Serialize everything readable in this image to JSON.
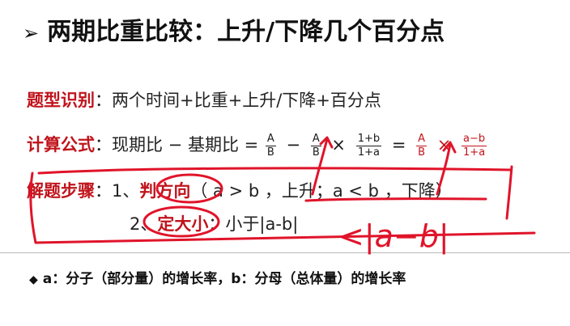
{
  "title": {
    "bullet": "➢",
    "text": "两期比重比较：上升/下降几个百分点"
  },
  "identify": {
    "label": "题型识别",
    "colon": "：",
    "text": "两个时间+比重+上升/下降+百分点"
  },
  "formula": {
    "label": "计算公式",
    "colon": "：",
    "text": "现期比 − 基期比 =",
    "f1": {
      "num": "A",
      "den": "B"
    },
    "minus": "−",
    "f2": {
      "num": "A",
      "den": "B"
    },
    "times1": "×",
    "f3": {
      "num": "1+b",
      "den": "1+a"
    },
    "eq": "=",
    "f4": {
      "num": "A",
      "den": "B"
    },
    "times2": "×",
    "f5": {
      "num": "a−b",
      "den": "1+a"
    }
  },
  "steps": {
    "label": "解题步骤",
    "colon": "：",
    "step1": {
      "num": "1、",
      "key": "判方向",
      "rest": "（ a > b ，上升；a < b ，下降）"
    },
    "step2": {
      "num": "2、",
      "key": "定大小",
      "rest": "：小于|a-b|"
    }
  },
  "handwriting": {
    "text": "<|a−b|",
    "color": "#e0142a"
  },
  "note": {
    "bullet": "◆",
    "text": "a：分子（部分量）的增长率，b：分母（总体量）的增长率"
  },
  "colors": {
    "accent": "#c0141c",
    "ink": "#e0142a"
  }
}
